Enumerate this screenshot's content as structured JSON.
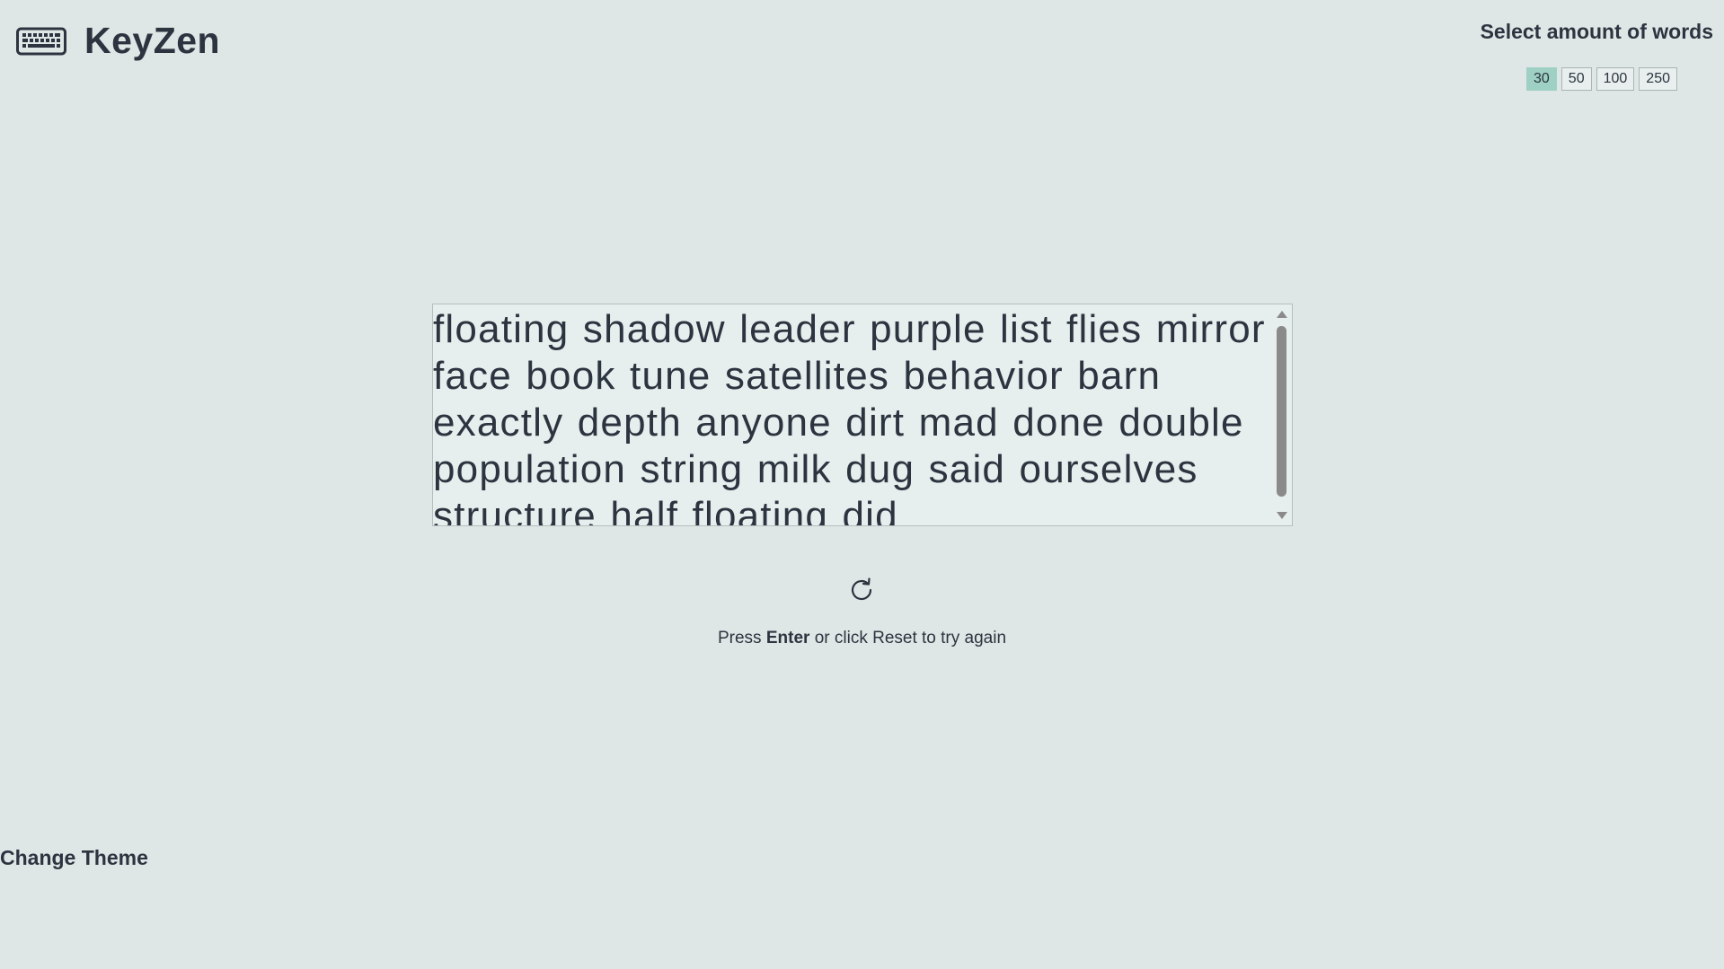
{
  "app": {
    "title": "KeyZen",
    "logo_icon": "keyboard-icon"
  },
  "word_select": {
    "title": "Select amount of words",
    "options": [
      "30",
      "50",
      "100",
      "250"
    ],
    "selected": "30",
    "active_color": "#9fd0c4"
  },
  "typing": {
    "text": "floating shadow leader purple list flies mirror face book tune satellites behavior barn exactly depth anyone dirt mad done double population string milk dug said ourselves structure half floating did"
  },
  "reset": {
    "icon": "reset-icon",
    "hint_prefix": "Press ",
    "hint_key": "Enter",
    "hint_suffix": " or click Reset to try again"
  },
  "theme": {
    "label": "Change Theme"
  },
  "colors": {
    "background": "#dfe7e6",
    "text": "#2c3440",
    "typing_box": "#e6efed"
  }
}
